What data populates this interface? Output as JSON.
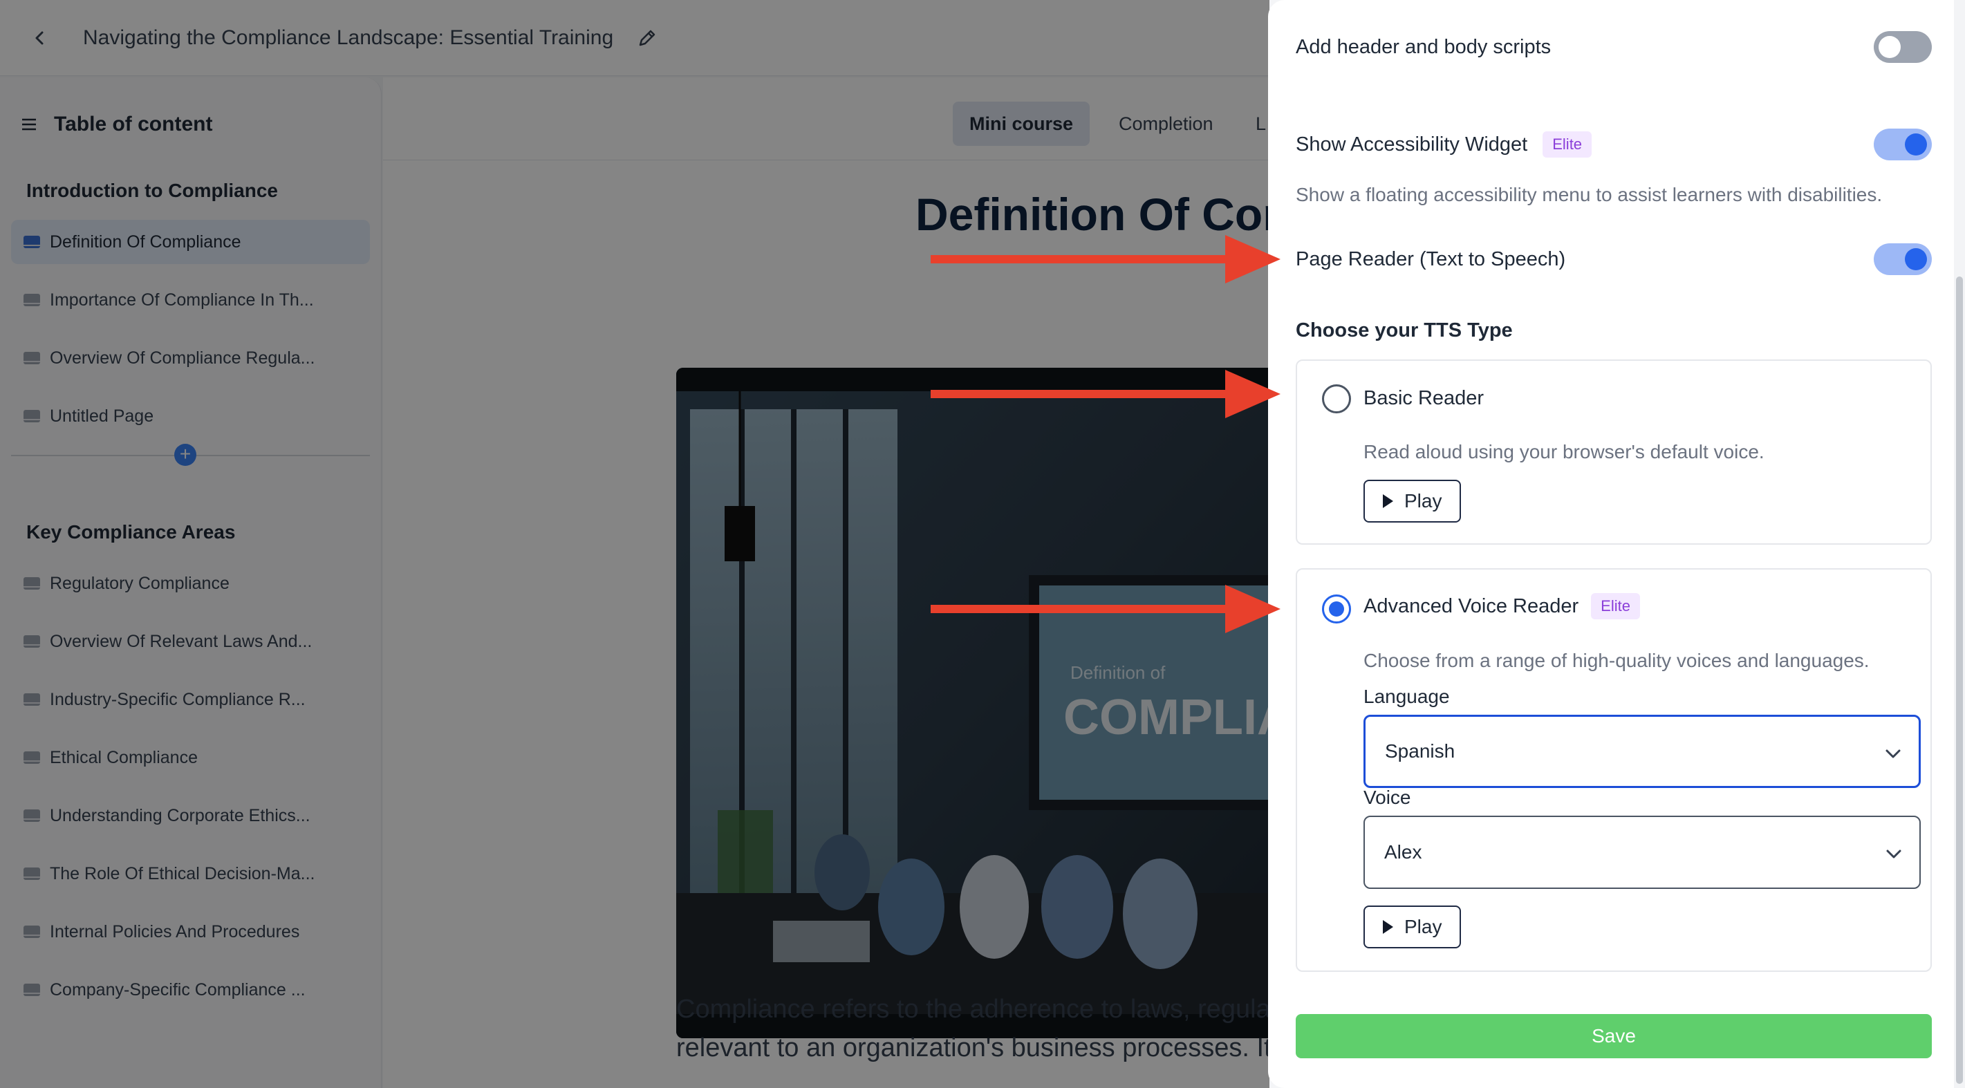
{
  "topbar": {
    "course_title": "Navigating the Compliance Landscape: Essential Training for..."
  },
  "sidebar": {
    "title": "Table of content",
    "sections": [
      {
        "title": "Introduction to Compliance",
        "items": [
          "Definition Of Compliance",
          "Importance Of Compliance In Th...",
          "Overview Of Compliance Regula...",
          "Untitled Page"
        ]
      },
      {
        "title": "Key Compliance Areas",
        "items": [
          "Regulatory Compliance",
          "Overview Of Relevant Laws And...",
          "Industry-Specific Compliance R...",
          "Ethical Compliance",
          "Understanding Corporate Ethics...",
          "The Role Of Ethical Decision-Ma...",
          "Internal Policies And Procedures",
          "Company-Specific Compliance ..."
        ]
      }
    ]
  },
  "main": {
    "tabs": [
      "Mini course",
      "Completion",
      "L"
    ],
    "heading": "Definition Of Com",
    "hero_caption_small": "Definition of",
    "hero_caption_big": "COMPLIAN",
    "body_line1": "Compliance refers to the adherence to laws, regulatio",
    "body_line2": "relevant to an organization's business processes. It is"
  },
  "panel": {
    "scripts_label": "Add header and body scripts",
    "accessibility_label": "Show Accessibility Widget",
    "accessibility_badge": "Elite",
    "accessibility_desc": "Show a floating accessibility menu to assist learners with disabilities.",
    "page_reader_label": "Page Reader (Text to Speech)",
    "tts_heading": "Choose your TTS Type",
    "basic": {
      "title": "Basic Reader",
      "desc": "Read aloud using your browser's default voice.",
      "play": "Play"
    },
    "advanced": {
      "title": "Advanced Voice Reader",
      "badge": "Elite",
      "desc": "Choose from a range of high-quality voices and languages.",
      "language_label": "Language",
      "language_value": "Spanish",
      "voice_label": "Voice",
      "voice_value": "Alex",
      "play": "Play"
    },
    "save": "Save",
    "toggles": {
      "scripts": false,
      "accessibility": true,
      "page_reader": true
    },
    "selected_tts": "advanced"
  },
  "colors": {
    "accent": "#2563eb",
    "save": "#5fcf6c",
    "badge_text": "#8b3fd9",
    "arrow": "#e8402c"
  }
}
